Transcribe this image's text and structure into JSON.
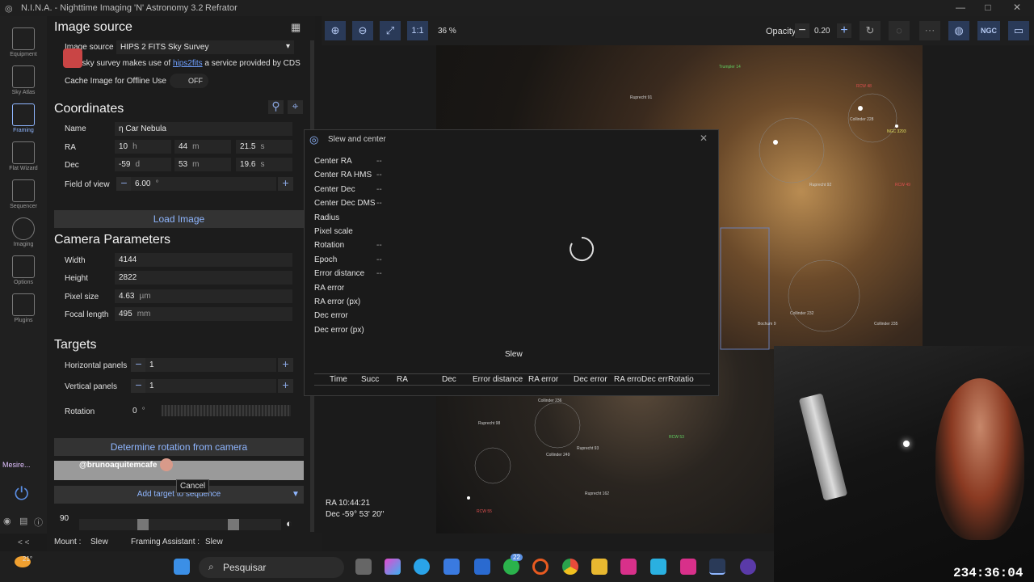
{
  "titlebar": {
    "title": "N.I.N.A. - Nighttime Imaging 'N' Astronomy 3.2",
    "profile": "Refrator"
  },
  "rail": [
    {
      "label": "Equipment"
    },
    {
      "label": "Sky Atlas"
    },
    {
      "label": "Framing"
    },
    {
      "label": "Flat Wizard"
    },
    {
      "label": "Sequencer"
    },
    {
      "label": "Imaging"
    },
    {
      "label": "Options"
    },
    {
      "label": "Plugins"
    }
  ],
  "image_source": {
    "heading": "Image source",
    "label": "Image source",
    "value": "HIPS 2 FITS Sky Survey",
    "notice_prefix": "This sky survey makes use of",
    "notice_link": "hips2fits",
    "notice_suffix": "a service provided by CDS",
    "cache_label": "Cache Image for Offline Use",
    "cache_toggle": "OFF"
  },
  "coordinates": {
    "heading": "Coordinates",
    "name_label": "Name",
    "name_value": "η Car Nebula",
    "ra_label": "RA",
    "ra_h": "10",
    "ra_h_unit": "h",
    "ra_m": "44",
    "ra_m_unit": "m",
    "ra_s": "21.5",
    "ra_s_unit": "s",
    "dec_label": "Dec",
    "dec_d": "-59",
    "dec_d_unit": "d",
    "dec_m": "53",
    "dec_m_unit": "m",
    "dec_s": "19.6",
    "dec_s_unit": "s",
    "fov_label": "Field of view",
    "fov_value": "6.00",
    "fov_unit": "°",
    "load_button": "Load Image"
  },
  "camera": {
    "heading": "Camera Parameters",
    "width_label": "Width",
    "width_value": "4144",
    "height_label": "Height",
    "height_value": "2822",
    "pixel_label": "Pixel size",
    "pixel_value": "4.63",
    "pixel_unit": "µm",
    "focal_label": "Focal length",
    "focal_value": "495",
    "focal_unit": "mm"
  },
  "targets": {
    "heading": "Targets",
    "hpanels_label": "Horizontal panels",
    "hpanels_value": "1",
    "vpanels_label": "Vertical panels",
    "vpanels_value": "1",
    "rotation_label": "Rotation",
    "rotation_value": "0",
    "rotation_unit": "°",
    "determine_button": "Determine rotation from camera",
    "add_button": "Add target to sequence",
    "overlay_user": "@brunoaquitemcafe",
    "overlay_left": "Mesire...",
    "cancel_tooltip": "Cancel"
  },
  "bottom_left": {
    "slider_value": "90",
    "collapse": "< <",
    "temp": "21°"
  },
  "toolbar": {
    "zoom_ratio": "1:1",
    "zoom_percent": "36 %",
    "opacity_label": "Opacity",
    "opacity_value": "0.20",
    "ngc": "NGC"
  },
  "sky_labels": {
    "ra": "RA  10:44:21",
    "dec": "Dec  -59° 53' 20\"",
    "items": [
      "Ruprecht 91",
      "Collinder 228",
      "NGC 3293",
      "RCW 49",
      "Ruprecht 92",
      "Ruprecht 162",
      "RCW 48",
      "Trumpler 14",
      "Collinder 232",
      "Ruprecht 93",
      "Collinder 236",
      "RCW 53",
      "Bochum 9",
      "Collinder 235",
      "Ruprecht 98",
      "Collinder 249",
      "RCW 55"
    ]
  },
  "dialog": {
    "title": "Slew and center",
    "rows": [
      {
        "label": "Center RA",
        "value": "--"
      },
      {
        "label": "Center RA HMS",
        "value": "--"
      },
      {
        "label": "Center Dec",
        "value": "--"
      },
      {
        "label": "Center Dec DMS",
        "value": "--"
      },
      {
        "label": "Radius",
        "value": ""
      },
      {
        "label": "Pixel scale",
        "value": ""
      },
      {
        "label": "Rotation",
        "value": "--"
      },
      {
        "label": "Epoch",
        "value": "--"
      },
      {
        "label": "Error distance",
        "value": "--"
      },
      {
        "label": "RA error",
        "value": ""
      },
      {
        "label": "RA error (px)",
        "value": ""
      },
      {
        "label": "Dec error",
        "value": ""
      },
      {
        "label": "Dec error (px)",
        "value": ""
      }
    ],
    "slew_label": "Slew",
    "columns": [
      "Time",
      "Succ",
      "RA",
      "Dec",
      "Error distance",
      "RA error",
      "Dec error",
      "RA erro",
      "Dec err",
      "Rotatio"
    ]
  },
  "statusbar": {
    "mount_label": "Mount :",
    "mount_value": "Slew",
    "fa_label": "Framing Assistant :",
    "fa_value": "Slew"
  },
  "taskbar": {
    "search_placeholder": "Pesquisar",
    "badge": "22"
  },
  "stream": {
    "timer": "234:36:04"
  },
  "colors": {
    "accent": "#8fb6ff",
    "panel": "#1c1c1c",
    "toolbar_btn": "#2a3a58"
  }
}
